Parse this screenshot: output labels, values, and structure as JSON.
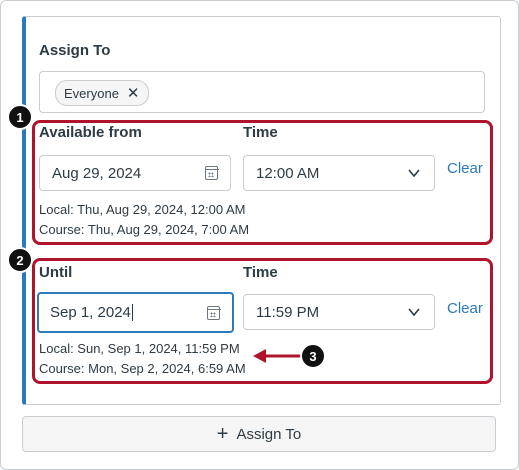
{
  "assign_to": {
    "label": "Assign To",
    "chips": [
      {
        "label": "Everyone",
        "remove_icon": "close-icon"
      }
    ]
  },
  "available_from": {
    "label": "Available from",
    "date_value": "Aug 29, 2024",
    "time_label": "Time",
    "time_value": "12:00 AM",
    "clear_label": "Clear",
    "local_note": "Local: Thu, Aug 29, 2024, 12:00 AM",
    "course_note": "Course: Thu, Aug 29, 2024, 7:00 AM",
    "badge": "1"
  },
  "until": {
    "label": "Until",
    "date_value": "Sep 1, 2024",
    "time_label": "Time",
    "time_value": "11:59 PM",
    "clear_label": "Clear",
    "local_note": "Local: Sun, Sep 1, 2024, 11:59 PM",
    "course_note": "Course: Mon, Sep 2, 2024, 6:59 AM",
    "badge": "2"
  },
  "callout_badge": "3",
  "add_assign": {
    "label": "Assign To",
    "icon": "plus-icon"
  },
  "colors": {
    "accent": "#2b7abc",
    "highlight": "#b0142c",
    "text": "#2d3b45",
    "border": "#c7cdd1"
  }
}
